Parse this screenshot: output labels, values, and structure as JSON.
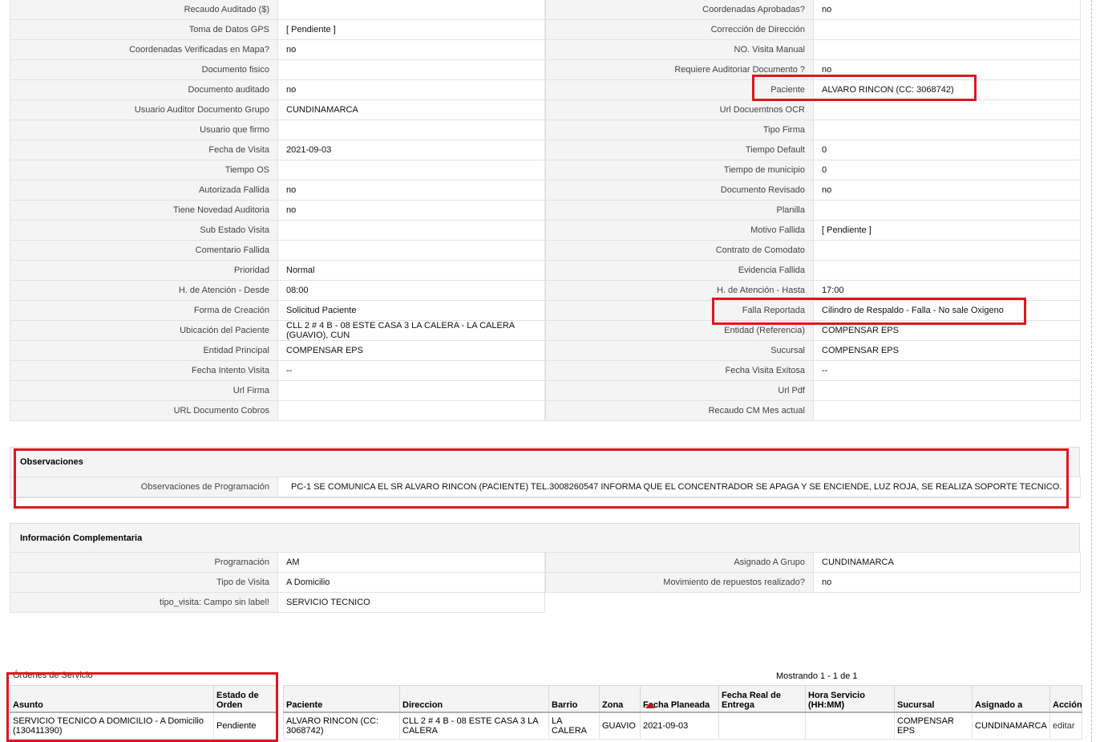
{
  "details": [
    {
      "l1": "Recaudo Auditado ($)",
      "v1": "",
      "l2": "Coordenadas Aprobadas?",
      "v2": "no"
    },
    {
      "l1": "Toma de Datos GPS",
      "v1": "[ Pendiente ]",
      "l2": "Corrección de Dirección",
      "v2": ""
    },
    {
      "l1": "Coordenadas Verificadas en Mapa?",
      "v1": "no",
      "l2": "NO. Visita Manual",
      "v2": ""
    },
    {
      "l1": "Documento fisico",
      "v1": "",
      "l2": "Requiere Auditoriar Documento ?",
      "v2": "no"
    },
    {
      "l1": "Documento auditado",
      "v1": "no",
      "l2": "Paciente",
      "v2": "ALVARO RINCON (CC: 3068742)"
    },
    {
      "l1": "Usuario Auditor Documento Grupo",
      "v1": "CUNDINAMARCA",
      "l2": "Url Docuemtnos OCR",
      "v2": ""
    },
    {
      "l1": "Usuario que firmo",
      "v1": "",
      "l2": "Tipo Firma",
      "v2": ""
    },
    {
      "l1": "Fecha de Visita",
      "v1": "2021-09-03",
      "l2": "Tiempo Default",
      "v2": "0"
    },
    {
      "l1": "Tiempo OS",
      "v1": "",
      "l2": "Tiempo de municipio",
      "v2": "0"
    },
    {
      "l1": "Autorizada Fallida",
      "v1": "no",
      "l2": "Documento Revisado",
      "v2": "no"
    },
    {
      "l1": "Tiene Novedad Auditoria",
      "v1": "no",
      "l2": "Planilla",
      "v2": ""
    },
    {
      "l1": "Sub Estado Visita",
      "v1": "",
      "l2": "Motivo Fallida",
      "v2": "[ Pendiente ]"
    },
    {
      "l1": "Comentario Fallida",
      "v1": "",
      "l2": "Contrato de Comodato",
      "v2": ""
    },
    {
      "l1": "Prioridad",
      "v1": "Normal",
      "l2": "Evidencia Fallida",
      "v2": ""
    },
    {
      "l1": "H. de Atención - Desde",
      "v1": "08:00",
      "l2": "H. de Atención - Hasta",
      "v2": "17:00"
    },
    {
      "l1": "Forma de Creación",
      "v1": "Solicitud Paciente",
      "l2": "Falla Reportada",
      "v2": "Cilindro de Respaldo - Falla - No sale Oxigeno"
    },
    {
      "l1": "Ubicación del Paciente",
      "v1": "CLL 2 # 4 B - 08 ESTE CASA 3 LA CALERA - LA CALERA (GUAVIO), CUN",
      "l2": "Entidad (Referencia)",
      "v2": "COMPENSAR EPS"
    },
    {
      "l1": "Entidad Principal",
      "v1": "COMPENSAR EPS",
      "l2": "Sucursal",
      "v2": "COMPENSAR EPS"
    },
    {
      "l1": "Fecha Intento Visita",
      "v1": "--",
      "l2": "Fecha Visita Exitosa",
      "v2": "--"
    },
    {
      "l1": "Url Firma",
      "v1": "",
      "l2": "Url Pdf",
      "v2": ""
    },
    {
      "l1": "URL Documento Cobros",
      "v1": "",
      "l2": "Recaudo CM Mes actual",
      "v2": ""
    }
  ],
  "observaciones": {
    "title": "Observaciones",
    "label": "Observaciones de Programación",
    "value": "PC-1 SE COMUNICA EL SR ALVARO RINCON (PACIENTE) TEL.3008260547 INFORMA QUE EL CONCENTRADOR SE APAGA Y SE ENCIENDE, LUZ ROJA, SE REALIZA SOPORTE TECNICO."
  },
  "complementaria": {
    "title": "Información Complementaria",
    "rows": [
      {
        "l1": "Programación",
        "v1": "AM",
        "l2": "Asignado A Grupo",
        "v2": "CUNDINAMARCA"
      },
      {
        "l1": "Tipo de Visita",
        "v1": "A Domicilio",
        "l2": "Movimiento de repuestos realizado?",
        "v2": "no"
      },
      {
        "l1": "tipo_visita: Campo sin label!",
        "v1": "SERVICIO TECNICO"
      }
    ]
  },
  "orders": {
    "caption": "Órdenes de Servicio",
    "showing": "Mostrando 1 - 1 de 1",
    "headers": [
      "Asunto",
      "Estado de Orden",
      "Paciente",
      "Direccion",
      "Barrio",
      "Zona",
      "Fecha Planeada",
      "Fecha Real de Entrega",
      "Hora Servicio (HH:MM)",
      "Sucursal",
      "Asignado a",
      "Acción"
    ],
    "row": [
      "SERVICIO TECNICO A DOMICILIO - A Domicilio (130411390)",
      "Pendiente",
      "ALVARO RINCON (CC: 3068742)",
      "CLL 2 # 4 B - 08 ESTE CASA 3 LA CALERA",
      "LA CALERA",
      "GUAVIO",
      "2021-09-03",
      "",
      "",
      "COMPENSAR EPS",
      "CUNDINAMARCA",
      "editar"
    ]
  },
  "colors": {
    "highlight": "#e0161e",
    "label_bg": "#f4f4f4"
  }
}
